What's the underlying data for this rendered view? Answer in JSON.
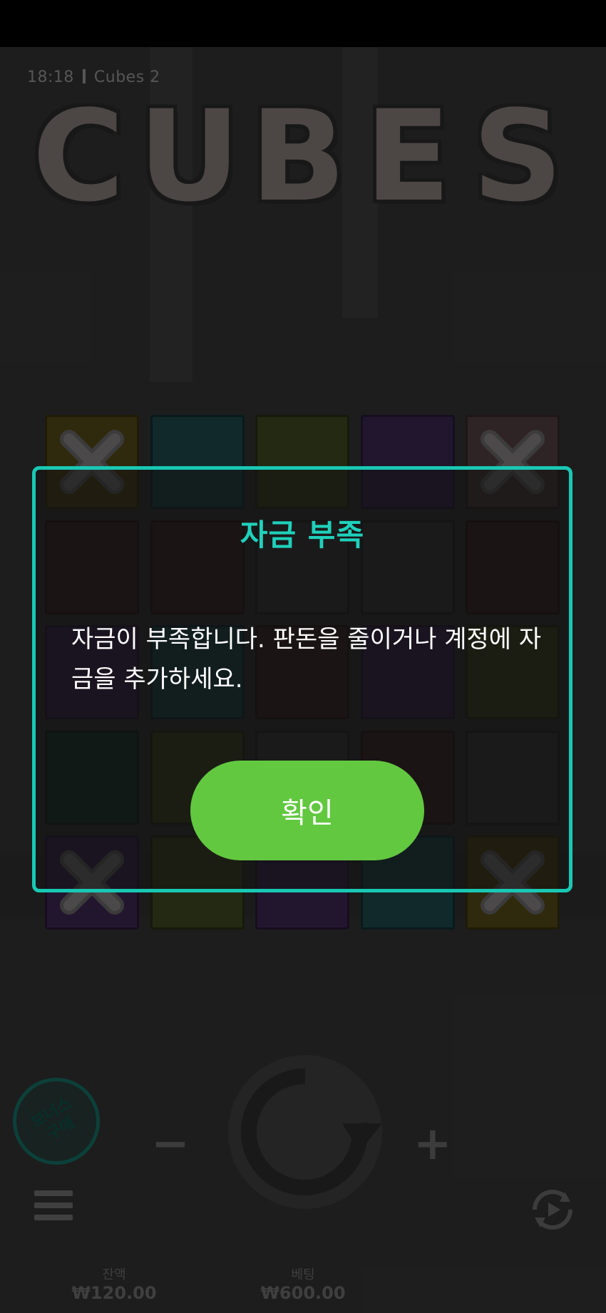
{
  "status_bar": {},
  "game": {
    "time": "18:18",
    "title": "Cubes 2",
    "logo_text": "CUBES",
    "grid": {
      "rows": 5,
      "cols": 5,
      "cells": [
        [
          "yellow-x",
          "teal",
          "olive",
          "purple",
          "pink-x"
        ],
        [
          "maroon",
          "maroon",
          "gray",
          "gray",
          "maroon"
        ],
        [
          "purple",
          "teal",
          "maroon",
          "purple",
          "olive"
        ],
        [
          "darkgreen",
          "olive",
          "gray",
          "maroon",
          "gray"
        ],
        [
          "purple-x",
          "olive",
          "purple",
          "teal",
          "yellow-x"
        ]
      ],
      "colors": {
        "yellow": "#3a3310",
        "teal": "#153234",
        "olive": "#2c3218",
        "purple": "#2a1c3a",
        "pink": "#3a2c2e",
        "maroon": "#2e1a1e",
        "gray": "#2d2a2b",
        "darkgreen": "#132820"
      }
    },
    "bonus_buy_label": "보너스 구매",
    "minus_label": "−",
    "plus_label": "+",
    "balance_label": "잔액",
    "balance_value": "₩120.00",
    "bet_label": "베팅",
    "bet_value": "₩600.00"
  },
  "dialog": {
    "title": "자금 부족",
    "message": "자금이 부족합니다. 판돈을 줄이거나 계정에 자금을 추가하세요.",
    "confirm_label": "확인",
    "accent_color": "#19c8b4",
    "button_color": "#62c840"
  }
}
